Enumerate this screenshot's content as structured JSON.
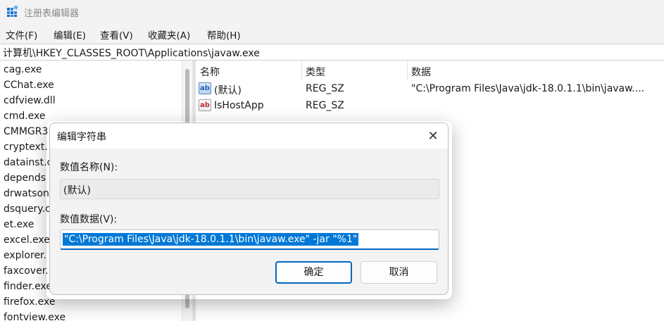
{
  "window": {
    "title": "注册表编辑器"
  },
  "menu": [
    "文件(F)",
    "编辑(E)",
    "查看(V)",
    "收藏夹(A)",
    "帮助(H)"
  ],
  "address": "计算机\\HKEY_CLASSES_ROOT\\Applications\\javaw.exe",
  "tree_items": [
    "cag.exe",
    "CChat.exe",
    "cdfview.dll",
    "cmd.exe",
    "CMMGR3",
    "cryptext.",
    "datainst.c",
    "depends",
    "drwatson",
    "dsquery.c",
    "et.exe",
    "excel.exe",
    "explorer.",
    "faxcover.",
    "finder.exe",
    "firefox.exe",
    "fontview.exe"
  ],
  "list": {
    "columns": [
      "名称",
      "类型",
      "数据"
    ],
    "rows": [
      {
        "icon": "ab",
        "name": "(默认)",
        "type": "REG_SZ",
        "data": "\"C:\\Program Files\\Java\\jdk-18.0.1.1\\bin\\javaw...."
      },
      {
        "icon": "ab",
        "name": "IsHostApp",
        "type": "REG_SZ",
        "data": ""
      }
    ]
  },
  "dialog": {
    "title": "编辑字符串",
    "close_glyph": "✕",
    "name_label": "数值名称(N):",
    "name_value": "(默认)",
    "data_label": "数值数据(V):",
    "data_value": "\"C:\\Program Files\\Java\\jdk-18.0.1.1\\bin\\javaw.exe\" -jar \"%1\"",
    "ok_label": "确定",
    "cancel_label": "取消"
  },
  "colors": {
    "accent": "#0067c0",
    "selection": "#0078d7",
    "chrome": "#f3f3f3"
  },
  "icons": {
    "app": "registry-editor-icon",
    "value": "string-value-icon",
    "close": "close-icon"
  }
}
